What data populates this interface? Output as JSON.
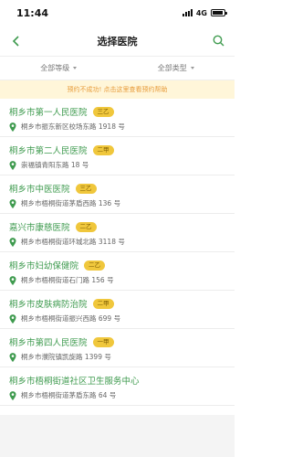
{
  "status": {
    "time": "11:44",
    "network": "4G"
  },
  "header": {
    "title": "选择医院"
  },
  "filters": {
    "level": "全部等级",
    "type": "全部类型"
  },
  "notice": {
    "text": "预约不成功! 点击这里查看预约帮助"
  },
  "hospitals": [
    {
      "name": "桐乡市第一人民医院",
      "level": "三乙",
      "address": "桐乡市振东新区校场东路 1918 号"
    },
    {
      "name": "桐乡市第二人民医院",
      "level": "二甲",
      "address": "崇福镇青阳东路 18 号"
    },
    {
      "name": "桐乡市中医医院",
      "level": "三乙",
      "address": "桐乡市梧桐街道茅盾西路 136 号"
    },
    {
      "name": "嘉兴市康慈医院",
      "level": "二乙",
      "address": "桐乡市梧桐街道环城北路 3118 号"
    },
    {
      "name": "桐乡市妇幼保健院",
      "level": "二乙",
      "address": "桐乡市梧桐街道石门路 156 号"
    },
    {
      "name": "桐乡市皮肤病防治院",
      "level": "二甲",
      "address": "桐乡市梧桐街道振兴西路 699 号"
    },
    {
      "name": "桐乡市第四人民医院",
      "level": "一甲",
      "address": "桐乡市濮院镇凯旋路 1399 号"
    },
    {
      "name": "桐乡市梧桐街道社区卫生服务中心",
      "level": "",
      "address": "桐乡市梧桐街道茅盾东路 64 号"
    }
  ],
  "colors": {
    "accent": "#3f9b4f",
    "badge": "#f0c73c",
    "notice_bg": "#fff6d9",
    "notice_text": "#e79b3a"
  }
}
